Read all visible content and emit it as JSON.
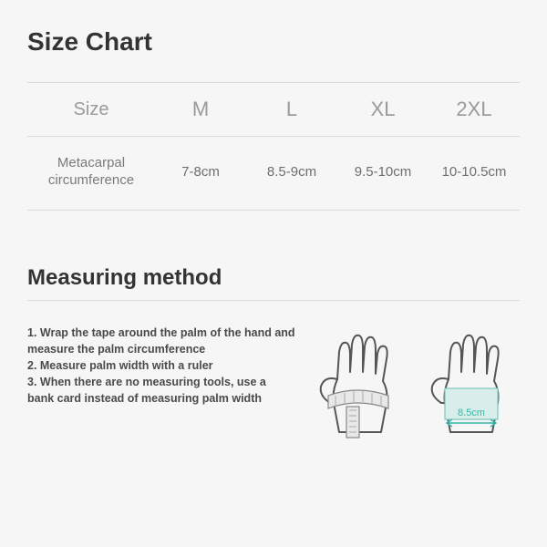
{
  "title": "Size Chart",
  "table": {
    "header": {
      "label": "Size",
      "cols": [
        "M",
        "L",
        "XL",
        "2XL"
      ]
    },
    "row": {
      "label": "Metacarpal\ncircumference",
      "values": [
        "7-8cm",
        "8.5-9cm",
        "9.5-10cm",
        "10-10.5cm"
      ]
    }
  },
  "method_title": "Measuring method",
  "steps": [
    "1. Wrap the tape around the palm of the hand and measure the palm circumference",
    "2. Measure palm width with a ruler",
    "3. When there are no measuring tools, use a bank card instead of measuring palm width"
  ],
  "illustration": {
    "width_label": "8.5cm"
  }
}
